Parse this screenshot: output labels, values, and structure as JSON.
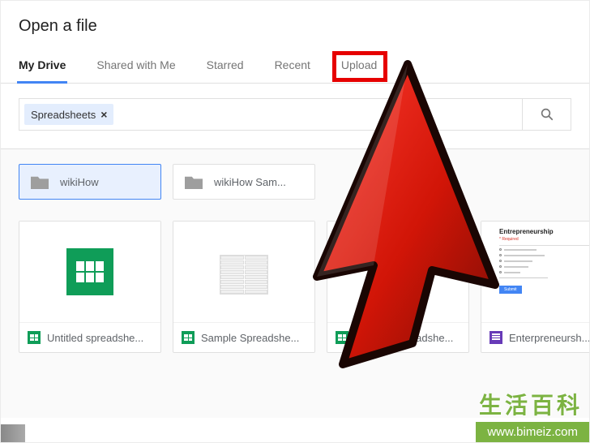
{
  "dialog": {
    "title": "Open a file"
  },
  "tabs": [
    {
      "label": "My Drive",
      "active": true
    },
    {
      "label": "Shared with Me",
      "active": false
    },
    {
      "label": "Starred",
      "active": false
    },
    {
      "label": "Recent",
      "active": false
    },
    {
      "label": "Upload",
      "active": false
    }
  ],
  "filter": {
    "chip_label": "Spreadsheets",
    "chip_close": "×",
    "search_placeholder": ""
  },
  "folders": [
    {
      "name": "wikiHow",
      "selected": true
    },
    {
      "name": "wikiHow Sam...",
      "selected": false
    }
  ],
  "files": [
    {
      "name": "Untitled spreadshe...",
      "type": "sheets",
      "thumb": "blank_sheets"
    },
    {
      "name": "Sample Spreadshe...",
      "type": "sheets",
      "thumb": "table"
    },
    {
      "name": "Sample Spreadshe...",
      "type": "sheets",
      "thumb": "blank_sheets"
    },
    {
      "name": "Enterpreneursh...",
      "type": "forms",
      "thumb": "form"
    }
  ],
  "form_thumb": {
    "title": "Entrepreneurship",
    "required": "* Required",
    "button": "Submit"
  },
  "highlight": {
    "target_tab_index": 4
  },
  "watermark": {
    "cn": "生活百科",
    "url": "www.bimeiz.com"
  }
}
